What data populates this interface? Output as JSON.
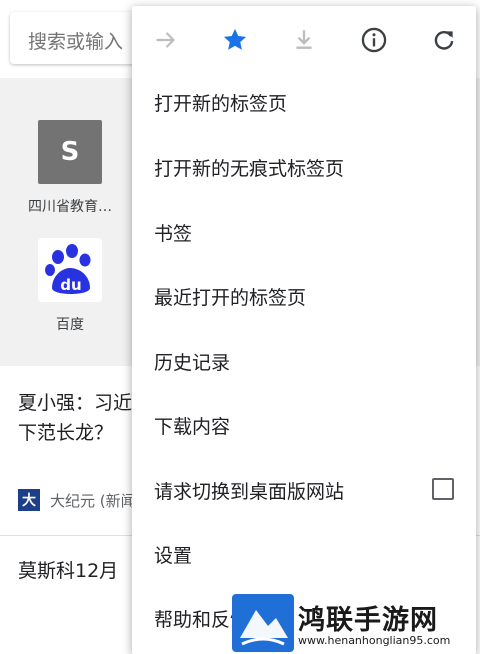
{
  "search": {
    "placeholder": "搜索或输入"
  },
  "shortcuts": [
    {
      "tile_letter": "S",
      "label": "四川省教育…",
      "icon": "site-letter-icon"
    },
    {
      "tile_letter": "du",
      "label": "百度",
      "icon": "baidu-paw-icon"
    }
  ],
  "articles": [
    {
      "title_line1": "夏小强：习近",
      "title_line2": "下范长龙？",
      "source_logo": "大",
      "source": "大纪元 (新闻"
    },
    {
      "title_line1": "莫斯科12月"
    }
  ],
  "menu": {
    "icons": [
      "forward-arrow-icon",
      "bookmark-star-icon",
      "download-icon",
      "info-icon",
      "refresh-icon"
    ],
    "items": [
      {
        "label": "打开新的标签页"
      },
      {
        "label": "打开新的无痕式标签页"
      },
      {
        "label": "书签"
      },
      {
        "label": "最近打开的标签页"
      },
      {
        "label": "历史记录"
      },
      {
        "label": "下载内容"
      },
      {
        "label": "请求切换到桌面版网站",
        "checkbox": false
      },
      {
        "label": "设置"
      },
      {
        "label": "帮助和反馈"
      }
    ]
  },
  "watermark": {
    "title": "鸿联手游网",
    "url": "www.henanhonglian95.com"
  },
  "colors": {
    "star_accent": "#1a73e8",
    "icon_gray": "#3c4043",
    "disabled_gray": "#bdbdbd",
    "baidu_blue": "#2932e1"
  }
}
